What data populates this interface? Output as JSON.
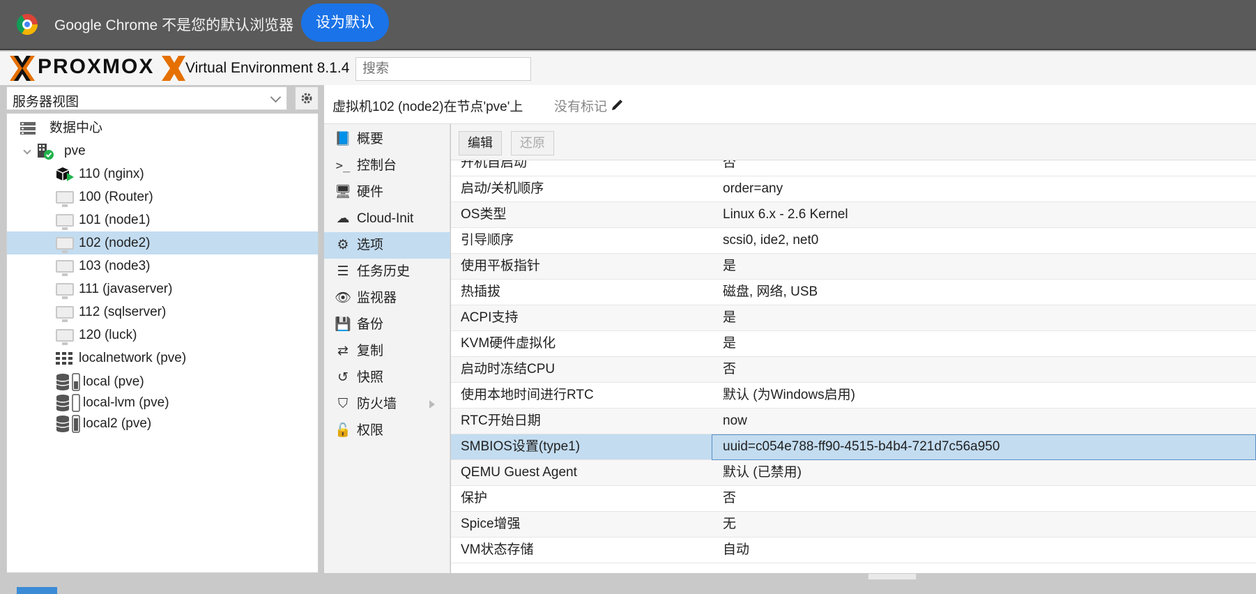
{
  "infobar": {
    "message": "Google Chrome 不是您的默认浏览器",
    "set_default_label": "设为默认"
  },
  "header": {
    "logo": "PROXMOX",
    "version": "Virtual Environment 8.1.4",
    "search_placeholder": "搜索"
  },
  "tree_panel": {
    "view_select": "服务器视图",
    "items": [
      {
        "label": "数据中心",
        "icon": "datacenter-icon"
      },
      {
        "label": "pve",
        "icon": "node-online-icon"
      },
      {
        "label": "110 (nginx)",
        "icon": "container-running-icon"
      },
      {
        "label": "100 (Router)",
        "icon": "vm-icon"
      },
      {
        "label": "101 (node1)",
        "icon": "vm-icon"
      },
      {
        "label": "102 (node2)",
        "icon": "vm-icon",
        "selected": true
      },
      {
        "label": "103 (node3)",
        "icon": "vm-icon"
      },
      {
        "label": "111 (javaserver)",
        "icon": "vm-icon"
      },
      {
        "label": "112 (sqlserver)",
        "icon": "vm-icon"
      },
      {
        "label": "120 (luck)",
        "icon": "vm-icon"
      },
      {
        "label": "localnetwork (pve)",
        "icon": "network-grid-icon"
      },
      {
        "label": "local (pve)",
        "icon": "storage-icon"
      },
      {
        "label": "local-lvm (pve)",
        "icon": "storage-icon"
      },
      {
        "label": "local2 (pve)",
        "icon": "storage-icon"
      }
    ]
  },
  "vm_header": {
    "title": "虚拟机102 (node2)在节点'pve'上",
    "tags": "没有标记"
  },
  "nav": {
    "items": [
      {
        "label": "概要",
        "icon": "book-icon"
      },
      {
        "label": "控制台",
        "icon": "terminal-icon"
      },
      {
        "label": "硬件",
        "icon": "monitor-icon"
      },
      {
        "label": "Cloud-Init",
        "icon": "cloud-icon"
      },
      {
        "label": "选项",
        "icon": "gear-icon",
        "active": true
      },
      {
        "label": "任务历史",
        "icon": "list-icon"
      },
      {
        "label": "监视器",
        "icon": "eye-icon"
      },
      {
        "label": "备份",
        "icon": "floppy-icon"
      },
      {
        "label": "复制",
        "icon": "retweet-icon"
      },
      {
        "label": "快照",
        "icon": "history-icon"
      },
      {
        "label": "防火墙",
        "icon": "shield-icon"
      },
      {
        "label": "权限",
        "icon": "unlock-icon"
      }
    ]
  },
  "toolbar": {
    "edit_label": "编辑",
    "revert_label": "还原"
  },
  "options": [
    {
      "key": "开机自启动",
      "value": "否"
    },
    {
      "key": "启动/关机顺序",
      "value": "order=any"
    },
    {
      "key": "OS类型",
      "value": "Linux 6.x - 2.6 Kernel"
    },
    {
      "key": "引导顺序",
      "value": "scsi0, ide2, net0"
    },
    {
      "key": "使用平板指针",
      "value": "是"
    },
    {
      "key": "热插拔",
      "value": "磁盘, 网络, USB"
    },
    {
      "key": "ACPI支持",
      "value": "是"
    },
    {
      "key": "KVM硬件虚拟化",
      "value": "是"
    },
    {
      "key": "启动时冻结CPU",
      "value": "否"
    },
    {
      "key": "使用本地时间进行RTC",
      "value": "默认 (为Windows启用)"
    },
    {
      "key": "RTC开始日期",
      "value": "now"
    },
    {
      "key": "SMBIOS设置(type1)",
      "value": "uuid=c054e788-ff90-4515-b4b4-721d7c56a950",
      "selected": true
    },
    {
      "key": "QEMU Guest Agent",
      "value": "默认 (已禁用)"
    },
    {
      "key": "保护",
      "value": "否"
    },
    {
      "key": "Spice增强",
      "value": "无"
    },
    {
      "key": "VM状态存储",
      "value": "自动"
    }
  ]
}
